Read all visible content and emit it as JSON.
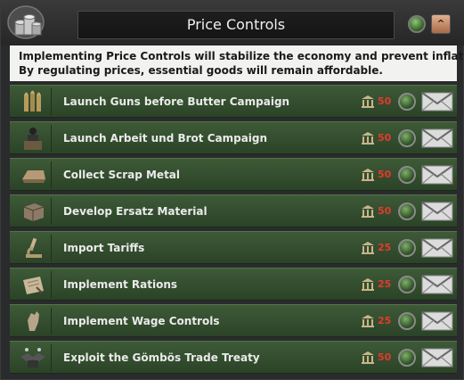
{
  "window": {
    "title": "Price Controls",
    "description": [
      "Implementing Price Controls will stabilize the economy and prevent inflation.",
      "By regulating prices, essential goods will remain affordable."
    ]
  },
  "header_icons": {
    "logo": "coins-icon",
    "toggle": "green-indicator-icon",
    "collapse": "collapse-up-icon",
    "collapse_glyph": "^"
  },
  "colors": {
    "row_bg": "#3d5a37",
    "cost_text": "#e33a2c",
    "description_bg": "#f2f2f0"
  },
  "decisions": [
    {
      "label": "Launch Guns before Butter Campaign",
      "cost": "50",
      "icon": "bullets-icon"
    },
    {
      "label": "Launch Arbeit und Brot Campaign",
      "cost": "50",
      "icon": "speaker-podium-icon"
    },
    {
      "label": "Collect Scrap Metal",
      "cost": "50",
      "icon": "metal-ingot-icon"
    },
    {
      "label": "Develop Ersatz Material",
      "cost": "50",
      "icon": "material-crate-icon"
    },
    {
      "label": "Import Tariffs",
      "cost": "25",
      "icon": "microscope-icon"
    },
    {
      "label": "Implement Rations",
      "cost": "25",
      "icon": "ration-paper-icon"
    },
    {
      "label": "Implement Wage Controls",
      "cost": "25",
      "icon": "hand-icon"
    },
    {
      "label": "Exploit the Gömbös Trade Treaty",
      "cost": "50",
      "icon": "handshake-icon"
    }
  ]
}
